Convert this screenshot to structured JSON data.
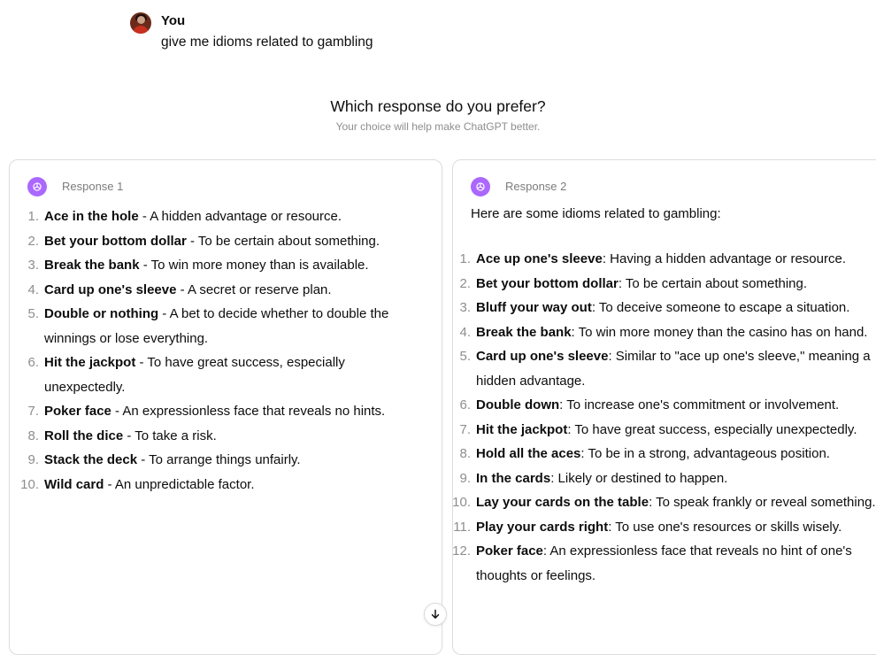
{
  "user": {
    "name": "You",
    "message": "give me idioms related to gambling"
  },
  "preference": {
    "title": "Which response do you prefer?",
    "subtitle": "Your choice will help make ChatGPT better."
  },
  "response1": {
    "label": "Response 1",
    "items": [
      {
        "num": "1.",
        "term": "Ace in the hole",
        "def": " - A hidden advantage or resource."
      },
      {
        "num": "2.",
        "term": "Bet your bottom dollar",
        "def": " - To be certain about something."
      },
      {
        "num": "3.",
        "term": "Break the bank",
        "def": " - To win more money than is available."
      },
      {
        "num": "4.",
        "term": "Card up one's sleeve",
        "def": " - A secret or reserve plan."
      },
      {
        "num": "5.",
        "term": "Double or nothing",
        "def": " - A bet to decide whether to double the winnings or lose everything."
      },
      {
        "num": "6.",
        "term": "Hit the jackpot",
        "def": " - To have great success, especially unexpectedly."
      },
      {
        "num": "7.",
        "term": "Poker face",
        "def": " - An expressionless face that reveals no hints."
      },
      {
        "num": "8.",
        "term": "Roll the dice",
        "def": " - To take a risk."
      },
      {
        "num": "9.",
        "term": "Stack the deck",
        "def": " - To arrange things unfairly."
      },
      {
        "num": "10.",
        "term": "Wild card",
        "def": " - An unpredictable factor."
      }
    ]
  },
  "response2": {
    "label": "Response 2",
    "intro": "Here are some idioms related to gambling:",
    "items": [
      {
        "num": "1.",
        "term": "Ace up one's sleeve",
        "def": ": Having a hidden advantage or resource."
      },
      {
        "num": "2.",
        "term": "Bet your bottom dollar",
        "def": ": To be certain about something."
      },
      {
        "num": "3.",
        "term": "Bluff your way out",
        "def": ": To deceive someone to escape a situation."
      },
      {
        "num": "4.",
        "term": "Break the bank",
        "def": ": To win more money than the casino has on hand."
      },
      {
        "num": "5.",
        "term": "Card up one's sleeve",
        "def": ": Similar to \"ace up one's sleeve,\" meaning a hidden advantage."
      },
      {
        "num": "6.",
        "term": "Double down",
        "def": ": To increase one's commitment or involvement."
      },
      {
        "num": "7.",
        "term": "Hit the jackpot",
        "def": ": To have great success, especially unexpectedly."
      },
      {
        "num": "8.",
        "term": "Hold all the aces",
        "def": ": To be in a strong, advantageous position."
      },
      {
        "num": "9.",
        "term": "In the cards",
        "def": ": Likely or destined to happen."
      },
      {
        "num": "10.",
        "term": "Lay your cards on the table",
        "def": ": To speak frankly or reveal something."
      },
      {
        "num": "11.",
        "term": "Play your cards right",
        "def": ": To use one's resources or skills wisely."
      },
      {
        "num": "12.",
        "term": "Poker face",
        "def": ": An expressionless face that reveals no hint of one's thoughts or feelings."
      }
    ]
  },
  "icons": {
    "gpt": "openai-logo-icon",
    "scroll": "arrow-down-icon",
    "gpt_color": "#ab68ff"
  }
}
